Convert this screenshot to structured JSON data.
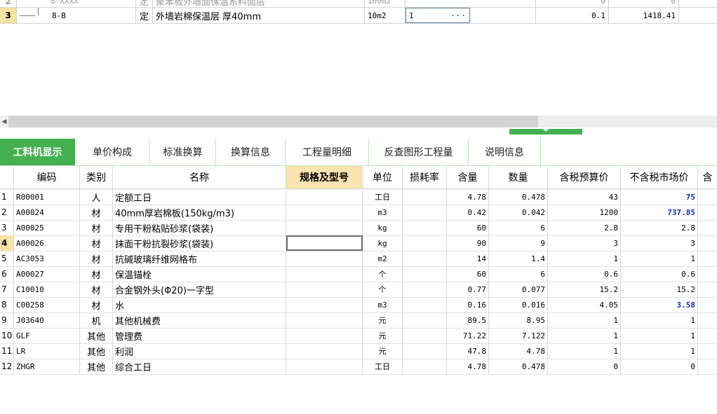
{
  "top_grid": {
    "partial_row": {
      "number": "2",
      "code": "8-XXXX",
      "type": "定",
      "name": "聚苯板外墙面保温系料面层",
      "unit": "100m2",
      "price": "0",
      "amount": "0"
    },
    "selected_row": {
      "number": "3",
      "code": "8-B",
      "type": "定",
      "name": "外墙岩棉保温层 厚40mm",
      "unit": "10m2",
      "quantity": "1",
      "quantity_button": "···",
      "price": "0.1",
      "amount": "1418.41"
    }
  },
  "scrollbar": {
    "left_arrow": "◀"
  },
  "tabs": [
    {
      "label": "工料机显示",
      "active": true
    },
    {
      "label": "单价构成"
    },
    {
      "label": "标准换算"
    },
    {
      "label": "换算信息"
    },
    {
      "label": "工程量明细"
    },
    {
      "label": "反查图形工程量"
    },
    {
      "label": "说明信息"
    }
  ],
  "resource_table": {
    "headers": {
      "code": "编码",
      "category": "类别",
      "name": "名称",
      "spec": "规格及型号",
      "unit": "单位",
      "loss_rate": "损耗率",
      "content": "含量",
      "quantity": "数量",
      "tax_budget_price": "含税预算价",
      "market_price_ex_tax": "不含税市场价",
      "extra": "含"
    },
    "rows": [
      {
        "num": "1",
        "code": "R00001",
        "category": "人",
        "name": "定额工日",
        "spec": "",
        "unit": "工日",
        "loss": "",
        "content": "4.78",
        "qty": "0.478",
        "budget": "43",
        "market": "75",
        "market_highlight": true
      },
      {
        "num": "2",
        "code": "A00024",
        "category": "材",
        "name": "40mm厚岩棉板(150kg/m3)",
        "spec": "",
        "unit": "m3",
        "loss": "",
        "content": "0.42",
        "qty": "0.042",
        "budget": "1200",
        "market": "737.85",
        "market_highlight": true
      },
      {
        "num": "3",
        "code": "A00025",
        "category": "材",
        "name": "专用干粉粘贴砂浆(袋装)",
        "spec": "",
        "unit": "kg",
        "loss": "",
        "content": "60",
        "qty": "6",
        "budget": "2.8",
        "market": "2.8"
      },
      {
        "num": "4",
        "code": "A00026",
        "category": "材",
        "name": "抹面干粉抗裂砂浆(袋装)",
        "spec": "",
        "unit": "kg",
        "loss": "",
        "content": "90",
        "qty": "9",
        "budget": "3",
        "market": "3",
        "selected": true
      },
      {
        "num": "5",
        "code": "AC3053",
        "category": "材",
        "name": "抗碱玻璃纤维网格布",
        "spec": "",
        "unit": "m2",
        "loss": "",
        "content": "14",
        "qty": "1.4",
        "budget": "1",
        "market": "1"
      },
      {
        "num": "6",
        "code": "A00027",
        "category": "材",
        "name": "保温锚栓",
        "spec": "",
        "unit": "个",
        "loss": "",
        "content": "60",
        "qty": "6",
        "budget": "0.6",
        "market": "0.6"
      },
      {
        "num": "7",
        "code": "C10010",
        "category": "材",
        "name": "合金钢外头(Φ20)一字型",
        "spec": "",
        "unit": "个",
        "loss": "",
        "content": "0.77",
        "qty": "0.077",
        "budget": "15.2",
        "market": "15.2"
      },
      {
        "num": "8",
        "code": "C00258",
        "category": "材",
        "name": "水",
        "spec": "",
        "unit": "m3",
        "loss": "",
        "content": "0.16",
        "qty": "0.016",
        "budget": "4.05",
        "market": "3.58",
        "market_highlight": true
      },
      {
        "num": "9",
        "code": "J03640",
        "category": "机",
        "name": "其他机械费",
        "spec": "",
        "unit": "元",
        "loss": "",
        "content": "89.5",
        "qty": "8.95",
        "budget": "1",
        "market": "1"
      },
      {
        "num": "10",
        "code": "GLF",
        "category": "其他",
        "name": "管理费",
        "spec": "",
        "unit": "元",
        "loss": "",
        "content": "71.22",
        "qty": "7.122",
        "budget": "1",
        "market": "1"
      },
      {
        "num": "11",
        "code": "LR",
        "category": "其他",
        "name": "利润",
        "spec": "",
        "unit": "元",
        "loss": "",
        "content": "47.8",
        "qty": "4.78",
        "budget": "1",
        "market": "1"
      },
      {
        "num": "12",
        "code": "ZHGR",
        "category": "其他",
        "name": "综合工日",
        "spec": "",
        "unit": "工日",
        "loss": "",
        "content": "4.78",
        "qty": "0.478",
        "budget": "0",
        "market": "0"
      }
    ]
  }
}
